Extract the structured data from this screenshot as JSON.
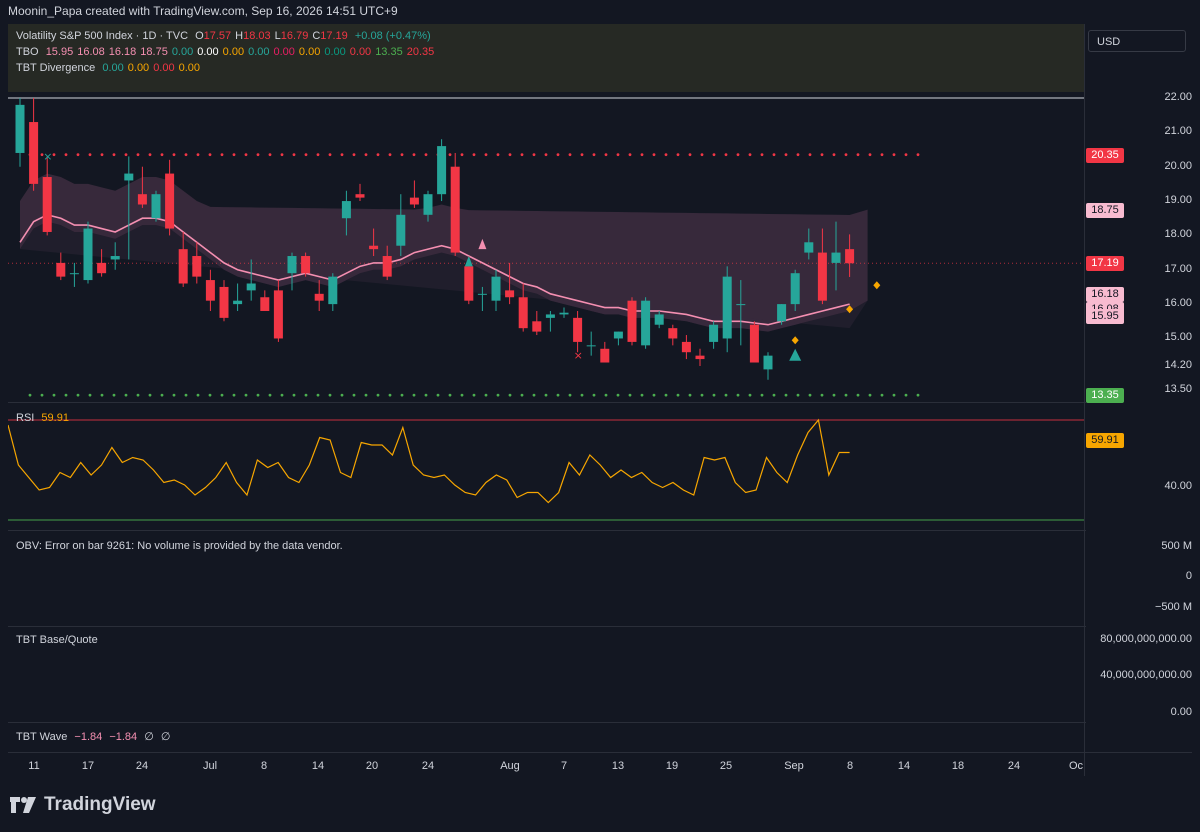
{
  "header": {
    "credit": "Moonin_Papa created with TradingView.com, Sep 16, 2026 14:51 UTC+9"
  },
  "legend": {
    "symbol": "Volatility S&P 500 Index · 1D · TVC",
    "ohlc": [
      {
        "k": "O",
        "v": "17.57"
      },
      {
        "k": "H",
        "v": "18.03"
      },
      {
        "k": "L",
        "v": "16.79"
      },
      {
        "k": "C",
        "v": "17.19"
      }
    ],
    "change": "+0.08 (+0.47%)",
    "tbo": {
      "name": "TBO",
      "values": [
        {
          "v": "15.95",
          "c": "#f48fb1"
        },
        {
          "v": "16.08",
          "c": "#f48fb1"
        },
        {
          "v": "16.18",
          "c": "#f48fb1"
        },
        {
          "v": "18.75",
          "c": "#f48fb1"
        },
        {
          "v": "0.00",
          "c": "#26a69a"
        },
        {
          "v": "0.00",
          "c": "#ffffff"
        },
        {
          "v": "0.00",
          "c": "#f7a600"
        },
        {
          "v": "0.00",
          "c": "#26a69a"
        },
        {
          "v": "0.00",
          "c": "#e91e63"
        },
        {
          "v": "0.00",
          "c": "#f7a600"
        },
        {
          "v": "0.00",
          "c": "#089981"
        },
        {
          "v": "0.00",
          "c": "#f23645"
        },
        {
          "v": "13.35",
          "c": "#4caf50"
        },
        {
          "v": "20.35",
          "c": "#f23645"
        }
      ]
    },
    "divergence": {
      "name": "TBT Divergence",
      "values": [
        {
          "v": "0.00",
          "c": "#26a69a"
        },
        {
          "v": "0.00",
          "c": "#f7a600"
        },
        {
          "v": "0.00",
          "c": "#f23645"
        },
        {
          "v": "0.00",
          "c": "#f7a600"
        }
      ]
    }
  },
  "price_scale": {
    "currency": "USD",
    "ticks": [
      "22.00",
      "21.00",
      "20.00",
      "19.00",
      "18.00",
      "17.00",
      "16.00",
      "15.00",
      "14.20",
      "13.50"
    ],
    "badges": [
      {
        "label": "20.35",
        "bg": "#f23645",
        "fg": "#ffffff"
      },
      {
        "label": "18.75",
        "bg": "#f8bbd0",
        "fg": "#131722"
      },
      {
        "label": "17.19",
        "bg": "#f23645",
        "fg": "#ffffff"
      },
      {
        "label": "16.18",
        "bg": "#f8bbd0",
        "fg": "#131722"
      },
      {
        "label": "16.08",
        "bg": "#f8bbd0",
        "fg": "#131722"
      },
      {
        "label": "15.95",
        "bg": "#f8bbd0",
        "fg": "#131722"
      },
      {
        "label": "13.35",
        "bg": "#4caf50",
        "fg": "#ffffff"
      }
    ]
  },
  "rsi": {
    "name": "RSI",
    "value": "59.91",
    "badge": "59.91",
    "tick": "40.00",
    "line_values": [
      68,
      52,
      47,
      42,
      43,
      49,
      47,
      53,
      48,
      52,
      59,
      53,
      55,
      54,
      50,
      45,
      46,
      44,
      40,
      43,
      47,
      53,
      45,
      40,
      54,
      51,
      53,
      47,
      45,
      52,
      63,
      62,
      49,
      47,
      61,
      60,
      60,
      56,
      67,
      52,
      48,
      47,
      48,
      44,
      41,
      40,
      45,
      48,
      46,
      39,
      41,
      41,
      37,
      41,
      53,
      48,
      56,
      52,
      47,
      50,
      47,
      49,
      45,
      43,
      45,
      42,
      40,
      55,
      54,
      55,
      45,
      41,
      42,
      55,
      49,
      45,
      56,
      65,
      70,
      48,
      57,
      57
    ]
  },
  "obv": {
    "error": "OBV: Error on bar 9261: No volume is provided by the data vendor.",
    "ticks": [
      "500 M",
      "0",
      "−500 M"
    ]
  },
  "base_quote": {
    "name": "TBT Base/Quote",
    "ticks": [
      "80,000,000,000.00",
      "40,000,000,000.00",
      "0.00"
    ]
  },
  "wave": {
    "name": "TBT Wave",
    "values": [
      "−1.84",
      "−1.84",
      "∅",
      "∅"
    ]
  },
  "x_axis": [
    {
      "label": "11"
    },
    {
      "label": "17"
    },
    {
      "label": "24"
    },
    {
      "label": "Jul"
    },
    {
      "label": "8"
    },
    {
      "label": "14"
    },
    {
      "label": "20"
    },
    {
      "label": "24"
    },
    {
      "label": "Aug"
    },
    {
      "label": "7"
    },
    {
      "label": "13"
    },
    {
      "label": "19"
    },
    {
      "label": "25"
    },
    {
      "label": "Sep"
    },
    {
      "label": "8"
    },
    {
      "label": "14"
    },
    {
      "label": "18"
    },
    {
      "label": "24"
    },
    {
      "label": "Oc"
    }
  ],
  "candles": [
    [
      20.4,
      22.0,
      20.0,
      21.8
    ],
    [
      21.3,
      22.0,
      19.3,
      19.5
    ],
    [
      19.7,
      20.3,
      18.0,
      18.1
    ],
    [
      17.2,
      17.5,
      16.7,
      16.8
    ],
    [
      16.9,
      17.2,
      16.5,
      16.9
    ],
    [
      16.7,
      18.4,
      16.6,
      18.2
    ],
    [
      17.2,
      17.6,
      16.8,
      16.9
    ],
    [
      17.3,
      17.8,
      17.0,
      17.4
    ],
    [
      19.6,
      20.3,
      17.3,
      19.8
    ],
    [
      19.2,
      20.0,
      18.8,
      18.9
    ],
    [
      18.5,
      19.3,
      18.4,
      19.2
    ],
    [
      19.8,
      20.2,
      18.0,
      18.2
    ],
    [
      17.6,
      18.1,
      16.5,
      16.6
    ],
    [
      17.4,
      17.8,
      16.6,
      16.8
    ],
    [
      16.7,
      17.0,
      15.8,
      16.1
    ],
    [
      16.5,
      16.7,
      15.5,
      15.6
    ],
    [
      16.0,
      16.6,
      15.8,
      16.1
    ],
    [
      16.4,
      17.3,
      16.1,
      16.6
    ],
    [
      16.2,
      16.4,
      15.8,
      15.8
    ],
    [
      16.4,
      16.7,
      14.9,
      15.0
    ],
    [
      16.9,
      17.5,
      16.4,
      17.4
    ],
    [
      17.4,
      17.5,
      16.8,
      16.9
    ],
    [
      16.3,
      16.7,
      15.8,
      16.1
    ],
    [
      16.0,
      16.9,
      15.8,
      16.8
    ],
    [
      18.5,
      19.3,
      18.0,
      19.0
    ],
    [
      19.2,
      19.5,
      19.0,
      19.1
    ],
    [
      17.7,
      18.2,
      17.4,
      17.6
    ],
    [
      17.4,
      17.7,
      16.7,
      16.8
    ],
    [
      17.7,
      19.2,
      17.4,
      18.6
    ],
    [
      19.1,
      19.6,
      18.8,
      18.9
    ],
    [
      18.6,
      19.3,
      18.4,
      19.2
    ],
    [
      19.2,
      20.8,
      19.0,
      20.6
    ],
    [
      20.0,
      20.4,
      17.4,
      17.5
    ],
    [
      17.1,
      17.4,
      16.0,
      16.1
    ],
    [
      16.3,
      16.5,
      15.8,
      16.3
    ],
    [
      16.1,
      17.0,
      15.8,
      16.8
    ],
    [
      16.4,
      17.2,
      16.0,
      16.2
    ],
    [
      16.2,
      16.6,
      15.2,
      15.3
    ],
    [
      15.5,
      15.8,
      15.1,
      15.2
    ],
    [
      15.6,
      15.8,
      15.2,
      15.7
    ],
    [
      15.7,
      15.9,
      15.6,
      15.75
    ],
    [
      15.6,
      15.8,
      14.6,
      14.9
    ],
    [
      14.8,
      15.2,
      14.5,
      14.8
    ],
    [
      14.7,
      14.9,
      14.3,
      14.3
    ],
    [
      15.0,
      15.2,
      14.8,
      15.2
    ],
    [
      16.1,
      16.2,
      14.8,
      14.9
    ],
    [
      14.8,
      16.2,
      14.7,
      16.1
    ],
    [
      15.4,
      15.8,
      15.3,
      15.7
    ],
    [
      15.3,
      15.4,
      14.8,
      15.0
    ],
    [
      14.9,
      15.1,
      14.4,
      14.6
    ],
    [
      14.5,
      14.7,
      14.2,
      14.4
    ],
    [
      14.9,
      15.5,
      14.7,
      15.4
    ],
    [
      15.0,
      17.1,
      14.6,
      16.8
    ],
    [
      16.0,
      16.7,
      14.8,
      16.0
    ],
    [
      15.4,
      15.5,
      14.3,
      14.3
    ],
    [
      14.1,
      14.6,
      13.8,
      14.5
    ],
    [
      15.5,
      16.0,
      15.4,
      16.0
    ],
    [
      16.0,
      17.0,
      15.8,
      16.9
    ],
    [
      17.5,
      18.2,
      17.3,
      17.8
    ],
    [
      17.5,
      18.2,
      16.0,
      16.1
    ],
    [
      17.2,
      18.4,
      16.4,
      17.5
    ],
    [
      17.6,
      18.03,
      16.79,
      17.19
    ]
  ],
  "pink_ma": [
    17.8,
    18.4,
    18.6,
    18.5,
    18.3,
    18.3,
    18.2,
    18.1,
    18.3,
    18.5,
    18.5,
    18.4,
    18.1,
    17.8,
    17.5,
    17.2,
    17.0,
    16.9,
    16.8,
    16.7,
    16.8,
    16.9,
    16.8,
    16.7,
    16.9,
    17.1,
    17.2,
    17.2,
    17.3,
    17.5,
    17.6,
    17.7,
    17.6,
    17.4,
    17.2,
    17.0,
    16.8,
    16.6,
    16.5,
    16.3,
    16.2,
    16.1,
    16.0,
    15.9,
    15.9,
    15.8,
    15.8,
    15.8,
    15.75,
    15.7,
    15.6,
    15.5,
    15.5,
    15.5,
    15.45,
    15.4,
    15.5,
    15.6,
    15.7,
    15.8,
    15.9,
    16.0
  ]
}
